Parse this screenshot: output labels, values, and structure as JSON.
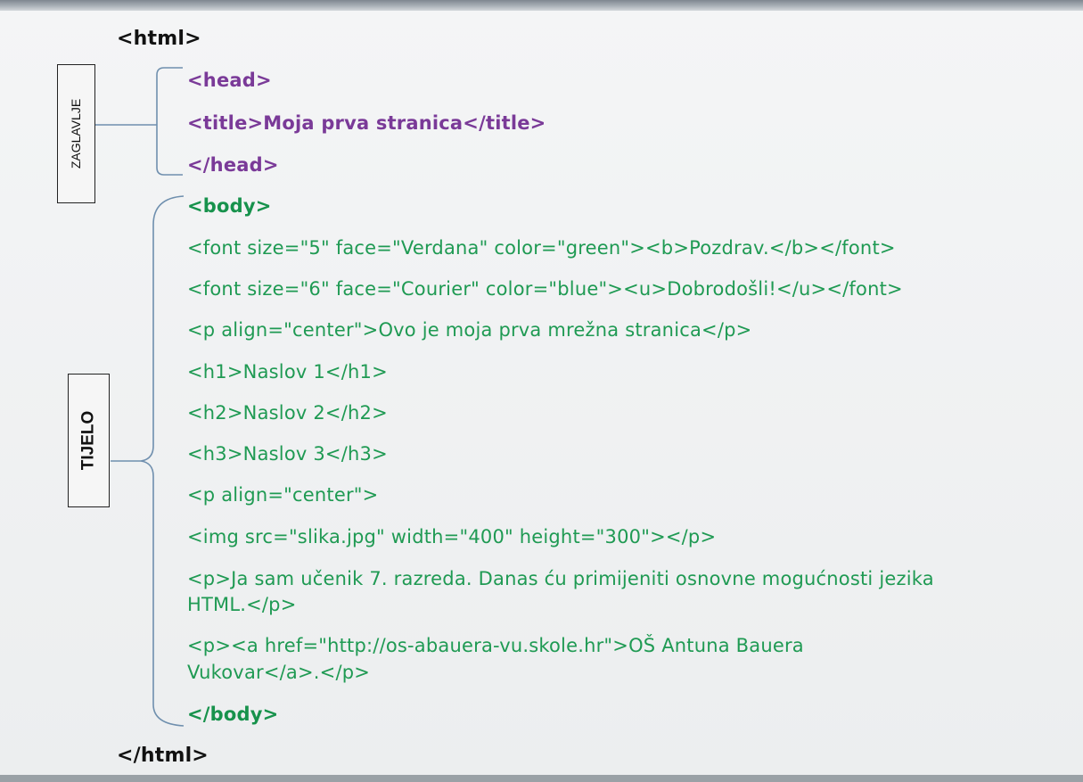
{
  "labels": {
    "head_label": "ZAGLAVLJE",
    "body_label": "TIJELO"
  },
  "code": {
    "html_open": "<html>",
    "head_open": "<head>",
    "title": "<title>Moja prva stranica</title>",
    "head_close": "</head>",
    "body_open": "<body>",
    "font_green": "<font size=\"5\" face=\"Verdana\" color=\"green\"><b>Pozdrav.</b></font>",
    "font_blue": "<font size=\"6\" face=\"Courier\" color=\"blue\"><u>Dobrodošli!</u></font>",
    "p_center_text": "<p align=\"center\">Ovo je moja prva mrežna stranica</p>",
    "h1": "<h1>Naslov 1</h1>",
    "h2": "<h2>Naslov 2</h2>",
    "h3": "<h3>Naslov 3</h3>",
    "p_center": "<p align=\"center\">",
    "img": "<img src=\"slika.jpg\" width=\"400\" height=\"300\"></p>",
    "p_ucenik_line1": "<p>Ja sam učenik 7. razreda. Danas ću primijeniti osnovne mogućnosti jezika",
    "p_ucenik_line2": "HTML.</p>",
    "p_link_line1": "<p><a href=\"http://os-abauera-vu.skole.hr\">OŠ Antuna Bauera",
    "p_link_line2": "Vukovar</a>.</p>",
    "body_close": "</body>",
    "html_close": "</html>"
  },
  "colors": {
    "outer_tags": "#111111",
    "head_section": "#7a3a98",
    "body_section": "#1f9a53",
    "bracket_lines": "#6f8fae"
  }
}
